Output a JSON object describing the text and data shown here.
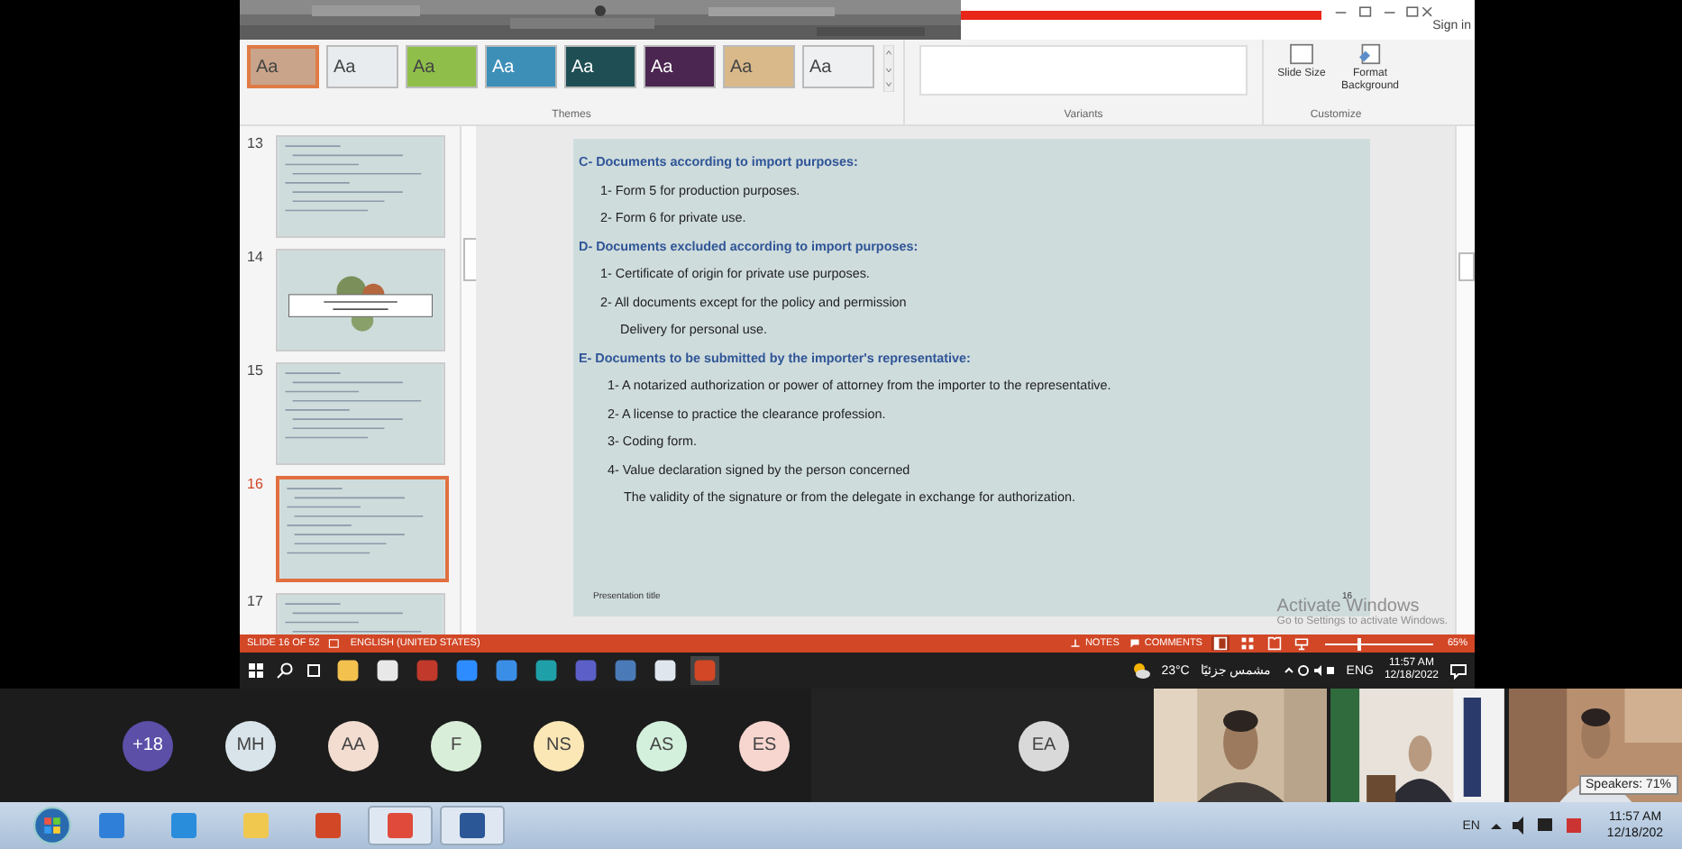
{
  "title_bar": {
    "sign_in": "Sign in"
  },
  "ribbon": {
    "themes": [
      {
        "label": "Aa",
        "color": "#c9a48a",
        "selected": true
      },
      {
        "label": "Aa",
        "color": "#e8ecef",
        "selected": false
      },
      {
        "label": "Aa",
        "color": "#8fbf4a",
        "selected": false
      },
      {
        "label": "Aa",
        "color": "#3d8fb8",
        "selected": false
      },
      {
        "label": "Aa",
        "color": "#1f4f55",
        "selected": false
      },
      {
        "label": "Aa",
        "color": "#4a2650",
        "selected": false
      },
      {
        "label": "Aa",
        "color": "#d9b98a",
        "selected": false
      },
      {
        "label": "Aa",
        "color": "#eef0f2",
        "selected": false
      }
    ],
    "groups": [
      "Themes",
      "Variants",
      "Customize"
    ],
    "buttons": [
      {
        "kind": "slide_size",
        "label": "Slide Size"
      },
      {
        "kind": "format_background",
        "label": "Format Background"
      }
    ]
  },
  "thumbnails": [
    {
      "number": "13",
      "kind": "text",
      "selected": false
    },
    {
      "number": "14",
      "kind": "title",
      "selected": false
    },
    {
      "number": "15",
      "kind": "text",
      "selected": false
    },
    {
      "number": "16",
      "kind": "text",
      "selected": true
    },
    {
      "number": "17",
      "kind": "text",
      "selected": false
    }
  ],
  "slide": {
    "lines": [
      {
        "kind": "heading",
        "text": "C- Documents according to import purposes:"
      },
      {
        "kind": "item",
        "text": "1- Form 5 for production purposes."
      },
      {
        "kind": "item",
        "text": "2- Form 6 for private use."
      },
      {
        "kind": "heading",
        "text": "D- Documents excluded according to import purposes:"
      },
      {
        "kind": "item",
        "text": "1- Certificate of origin for private use purposes."
      },
      {
        "kind": "item",
        "text": "2- All documents except for the policy and permission"
      },
      {
        "kind": "continuation",
        "text": "Delivery for personal use."
      },
      {
        "kind": "heading",
        "text": "E- Documents to be submitted by the importer's representative:"
      },
      {
        "kind": "subitem",
        "text": "1- A notarized authorization or power of attorney from the importer to the representative."
      },
      {
        "kind": "subitem",
        "text": "2- A license to practice the clearance profession."
      },
      {
        "kind": "subitem",
        "text": "3- Coding form."
      },
      {
        "kind": "subitem",
        "text": "4- Value declaration signed by the person concerned"
      },
      {
        "kind": "subcontinuation",
        "text": "The validity of the signature or from the delegate in exchange for authorization."
      }
    ],
    "footer": "Presentation title",
    "page_number": "16"
  },
  "activation": {
    "title": "Activate Windows",
    "subtitle": "Go to Settings to activate Windows."
  },
  "status_bar": {
    "slide": "SLIDE 16 OF 52",
    "language": "ENGLISH (UNITED STATES)",
    "notes": "NOTES",
    "comments": "COMMENTS",
    "views": [
      {
        "kind": "normal",
        "selected": true
      },
      {
        "kind": "sorter",
        "selected": false
      },
      {
        "kind": "reading",
        "selected": false
      },
      {
        "kind": "slideshow",
        "selected": false
      }
    ],
    "zoom": {
      "level": 0.3
    },
    "zoom_text": "65%"
  },
  "taskbar": {
    "apps": [
      {
        "kind": "explorer",
        "selected": false
      },
      {
        "kind": "store",
        "selected": false
      },
      {
        "kind": "access",
        "selected": false
      },
      {
        "kind": "zoom",
        "selected": false
      },
      {
        "kind": "mail",
        "selected": false
      },
      {
        "kind": "edge",
        "selected": false
      },
      {
        "kind": "teams",
        "selected": false
      },
      {
        "kind": "remote",
        "selected": false
      },
      {
        "kind": "calculator",
        "selected": false
      },
      {
        "kind": "powerpoint",
        "selected": true
      }
    ],
    "temperature": "23°C",
    "weather": "مشمس جزئيًا",
    "language": "ENG",
    "time": "11:57 AM",
    "date": "12/18/2022"
  },
  "participants": [
    {
      "initials": "+18",
      "color": "#5b4fa8"
    },
    {
      "initials": "MH",
      "color": "#d8e4ea"
    },
    {
      "initials": "AA",
      "color": "#f2ddd0"
    },
    {
      "initials": "F",
      "color": "#d9eed9"
    },
    {
      "initials": "NS",
      "color": "#fbe7b5"
    },
    {
      "initials": "AS",
      "color": "#d3f0dc"
    },
    {
      "initials": "ES",
      "color": "#f8d6d0"
    },
    {
      "initials": "EA",
      "color": "#d9d9d9"
    }
  ],
  "speaker_tooltip": "Speakers: 71%",
  "system_taskbar": {
    "apps": [
      {
        "kind": "media",
        "selected": false
      },
      {
        "kind": "ie",
        "selected": false
      },
      {
        "kind": "folder",
        "selected": false
      },
      {
        "kind": "powerpoint",
        "selected": false
      },
      {
        "kind": "chrome",
        "selected": true
      },
      {
        "kind": "word",
        "selected": true
      }
    ],
    "language": "EN",
    "time": "11:57 AM",
    "date": "12/18/202"
  }
}
